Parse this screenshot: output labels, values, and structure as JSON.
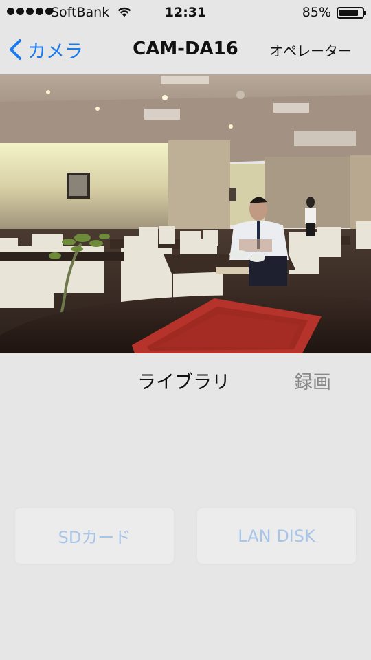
{
  "status_bar": {
    "carrier": "SoftBank",
    "time": "12:31",
    "battery_percent": "85%",
    "battery_level": 0.85,
    "signal_dots": 5
  },
  "nav": {
    "back_label": "カメラ",
    "title": "CAM-DA16",
    "right_button": "オペレーター"
  },
  "camera_feed": {
    "description_icon": "live-camera-image"
  },
  "segments": {
    "library": "ライブラリ",
    "record": "録画"
  },
  "storage": {
    "sd_label": "SDカード",
    "lan_label": "LAN DISK"
  },
  "colors": {
    "accent": "#1a7bf0",
    "background": "#e6e6e6",
    "disabled_text": "#a7c5e8"
  }
}
